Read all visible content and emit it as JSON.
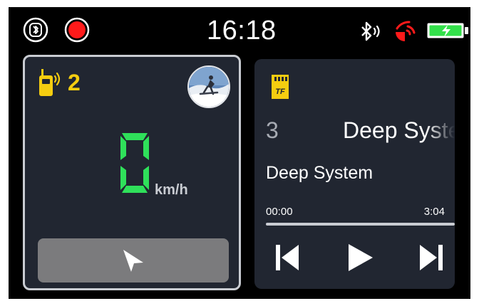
{
  "status_bar": {
    "time": "16:18",
    "icons": [
      "bluetooth-toggle-icon",
      "record-icon",
      "bluetooth-audio-icon",
      "signal-icon",
      "battery-charging-icon"
    ],
    "colors": {
      "record": "#ff1a1a",
      "signal": "#ff1a1a",
      "battery": "#33e04a"
    }
  },
  "speed_panel": {
    "intercom_count": "2",
    "speed": "0",
    "unit": "km/h",
    "colors": {
      "accent": "#f5cd10",
      "speed": "#2fe05a",
      "card": "#212631",
      "border": "#c9ccd2"
    }
  },
  "music_panel": {
    "source_icon": "tf-card-icon",
    "track_number": "3",
    "scrolling_title": "Deep System",
    "title": "Deep System",
    "elapsed": "00:00",
    "duration": "3:04",
    "progress": 0.0,
    "controls": [
      "previous-track",
      "play",
      "next-track"
    ]
  }
}
